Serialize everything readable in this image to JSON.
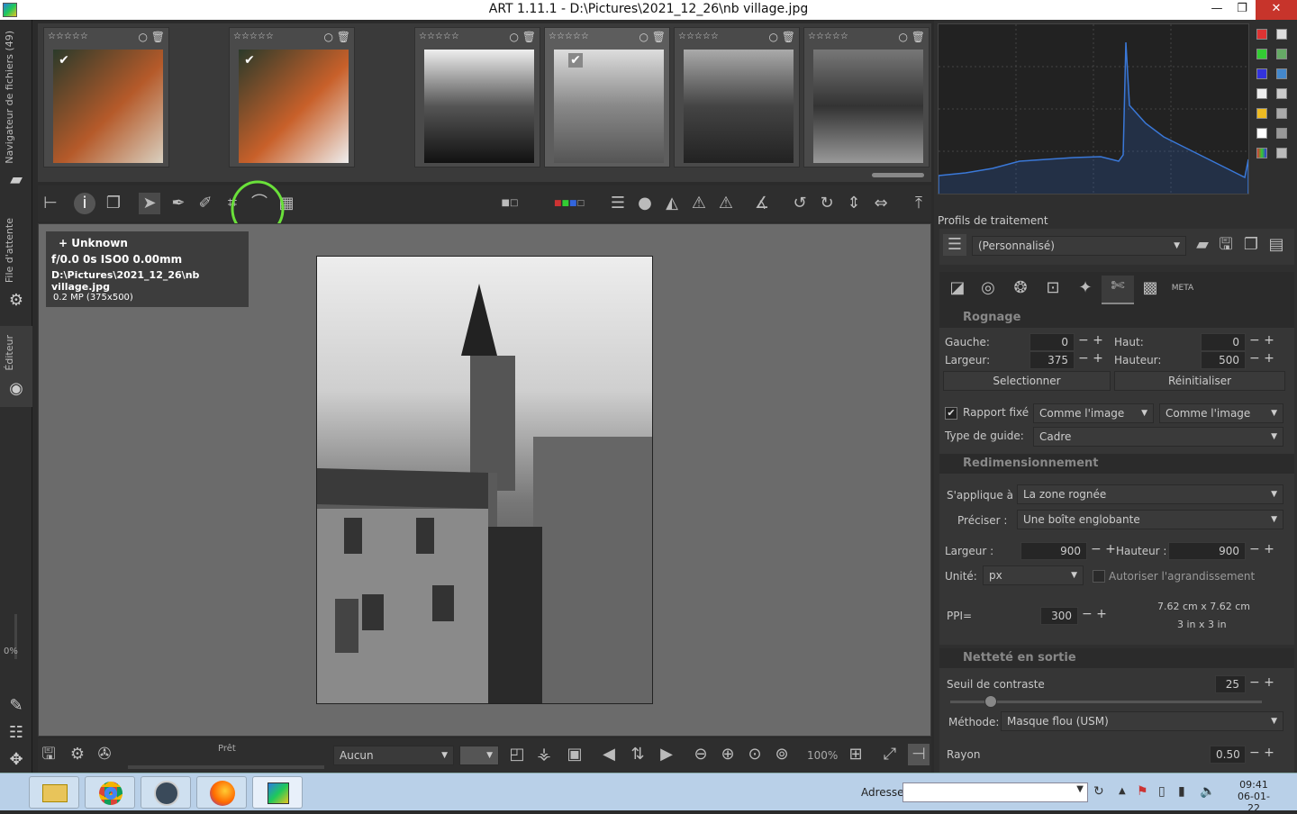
{
  "window": {
    "title": "ART 1.11.1 - D:\\Pictures\\2021_12_26\\nb village.jpg",
    "minimize": "—",
    "restore": "❐",
    "close": "✕"
  },
  "leftbar": {
    "file_browser": "Navigateur de fichiers (49)",
    "queue": "File d'attente",
    "editor": "Éditeur",
    "zoom_pct": "0%"
  },
  "thumbnails": [
    {
      "stars": "☆☆☆☆☆"
    },
    {
      "stars": "☆☆☆☆☆"
    },
    {
      "stars": "☆☆☆☆☆"
    },
    {
      "stars": "☆☆☆☆☆"
    },
    {
      "stars": "☆☆☆☆☆"
    },
    {
      "stars": "☆☆☆☆☆"
    }
  ],
  "info": {
    "camera": "+ Unknown",
    "exposure": "f/0.0  0s  ISO0  0.00mm",
    "path": "D:\\Pictures\\2021_12_26\\nb village.jpg",
    "size": "0.2 MP (375x500)"
  },
  "bottombar": {
    "status": "Prêt",
    "profile_combo": "Aucun",
    "zoom": "100%"
  },
  "right": {
    "profiles_label": "Profils de traitement",
    "profile_value": "(Personnalisé)",
    "crop": {
      "title": "Rognage",
      "left_label": "Gauche:",
      "left": "0",
      "top_label": "Haut:",
      "top": "0",
      "width_label": "Largeur:",
      "width": "375",
      "height_label": "Hauteur:",
      "height": "500",
      "select": "Selectionner",
      "reset": "Réinitialiser",
      "ratio_label": "Rapport fixé",
      "ratio1": "Comme l'image",
      "ratio2": "Comme l'image",
      "guide_label": "Type de guide:",
      "guide": "Cadre"
    },
    "resize": {
      "title": "Redimensionnement",
      "applies_label": "S'applique à :",
      "applies": "La zone rognée",
      "specify_label": "Préciser :",
      "specify": "Une boîte englobante",
      "width_label": "Largeur :",
      "width": "900",
      "height_label": "Hauteur :",
      "height": "900",
      "unit_label": "Unité:",
      "unit": "px",
      "allow_up": "Autoriser l'agrandissement",
      "ppi_label": "PPI=",
      "ppi": "300",
      "cm": "7.62 cm x 7.62 cm",
      "in": "3 in x 3 in"
    },
    "sharpen": {
      "title": "Netteté en sortie",
      "threshold_label": "Seuil de contraste",
      "threshold": "25",
      "method_label": "Méthode:",
      "method": "Masque flou (USM)",
      "radius_label": "Rayon",
      "radius": "0.50"
    },
    "tab_meta": "META"
  },
  "taskbar": {
    "address_label": "Adresse",
    "time": "09:41",
    "date": "06-01-22"
  }
}
